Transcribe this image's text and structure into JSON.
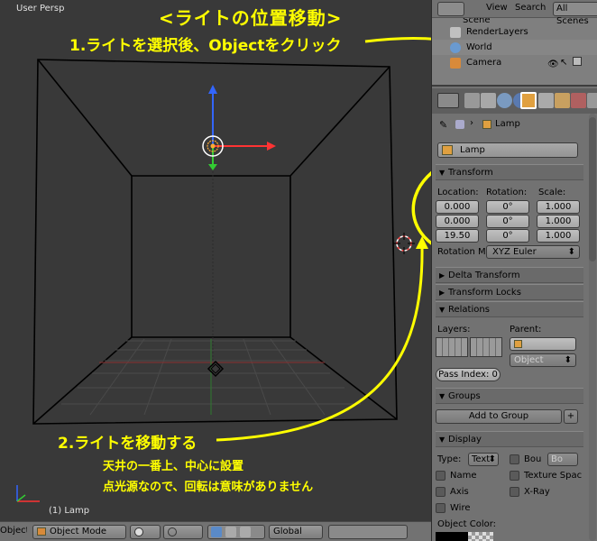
{
  "viewport": {
    "persp_label": "User Persp",
    "object_label": "(1) Lamp"
  },
  "annotations": {
    "title": "<ライトの位置移動>",
    "step1": "1.ライトを選択後、Objectをクリック",
    "step2": "2.ライトを移動する",
    "note1": "天井の一番上、中心に設置",
    "note2": "点光源なので、回転は意味がありません",
    "color": "#ffff00"
  },
  "bottom_bar": {
    "object_menu": "Object",
    "mode": "Object Mode",
    "orientation": "Global"
  },
  "outliner": {
    "header": {
      "view": "View",
      "search": "Search",
      "scenes": "All Scenes"
    },
    "items": [
      {
        "label": "Scene",
        "icon": "scene-icon"
      },
      {
        "label": "RenderLayers",
        "icon": "renderlayers-icon"
      },
      {
        "label": "World",
        "icon": "world-icon"
      },
      {
        "label": "Camera",
        "icon": "camera-icon"
      }
    ]
  },
  "properties": {
    "breadcrumb_object": "Lamp",
    "object_name": "Lamp",
    "transform": {
      "header": "Transform",
      "location_label": "Location:",
      "rotation_label": "Rotation:",
      "scale_label": "Scale:",
      "location": [
        "0.000",
        "0.000",
        "19.50"
      ],
      "rotation": [
        "0°",
        "0°",
        "0°"
      ],
      "scale": [
        "1.000",
        "1.000",
        "1.000"
      ],
      "rotation_mode_label": "Rotation M",
      "rotation_mode": "XYZ Euler"
    },
    "delta_transform": "Delta Transform",
    "transform_locks": "Transform Locks",
    "relations": {
      "header": "Relations",
      "layers_label": "Layers:",
      "parent_label": "Parent:",
      "parent_type": "Object",
      "pass_index": "Pass Index: 0"
    },
    "groups": {
      "header": "Groups",
      "add_button": "Add to Group"
    },
    "display": {
      "header": "Display",
      "type_label": "Type:",
      "type_value": "Text",
      "bounds_label": "Bou",
      "bounds_value": "Bo",
      "name_label": "Name",
      "texture_space_label": "Texture Spac",
      "axis_label": "Axis",
      "xray_label": "X-Ray",
      "wire_label": "Wire",
      "object_color_label": "Object Color:"
    }
  },
  "colors": {
    "viewport_bg": "#393939",
    "panel_bg": "#727272",
    "annotation": "#ffff00",
    "axis_x": "#ff3333",
    "axis_y": "#33cc33",
    "axis_z": "#3366ff"
  }
}
